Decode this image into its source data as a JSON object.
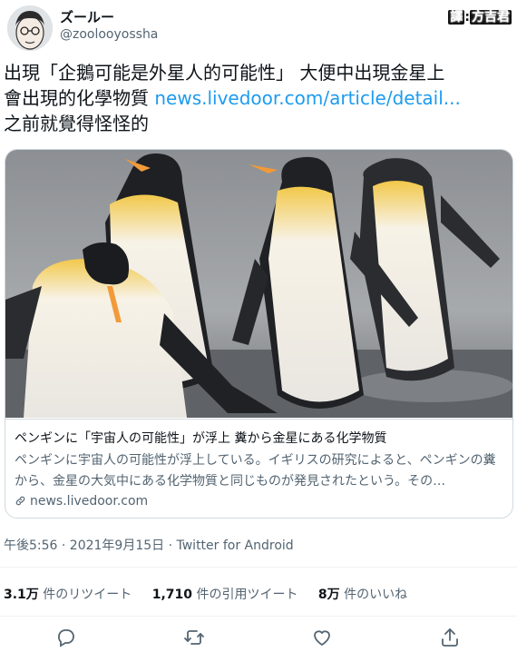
{
  "user": {
    "display_name": "ズールー",
    "handle": "@zoolooyossha"
  },
  "translator_tag": {
    "prefix": "譯",
    "name": "方吉君"
  },
  "tweet": {
    "line1": "出現「企鵝可能是外星人的可能性」 大便中出現金星上",
    "line2": "會出現的化學物質 ",
    "link": "news.livedoor.com/article/detail...",
    "line3": "之前就覺得怪怪的"
  },
  "card": {
    "title": "ペンギンに「宇宙人の可能性」が浮上 糞から金星にある化学物質",
    "description": "ペンギンに宇宙人の可能性が浮上している。イギリスの研究によると、ペンギンの糞から、金星の大気中にある化学物質と同じものが発見されたという。その…",
    "domain": "news.livedoor.com"
  },
  "meta": {
    "timestamp": "午後5:56 · 2021年9月15日 · Twitter for Android"
  },
  "stats": {
    "retweets_count": "3.1万",
    "retweets_label": " 件のリツイート",
    "quotes_count": "1,710",
    "quotes_label": " 件の引用ツイート",
    "likes_count": "8万",
    "likes_label": " 件のいいね"
  },
  "icons": {
    "reply": "reply-icon",
    "retweet": "retweet-icon",
    "like": "like-icon",
    "share": "share-icon",
    "link": "link-icon"
  },
  "colors": {
    "link": "#1d9bf0",
    "secondary_text": "#536471",
    "border": "#cfd9de"
  }
}
